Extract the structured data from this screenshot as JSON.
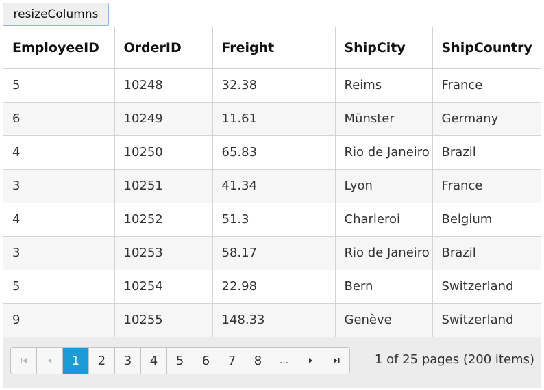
{
  "toolbar": {
    "resize_label": "resizeColumns"
  },
  "grid": {
    "columns": [
      "EmployeeID",
      "OrderID",
      "Freight",
      "ShipCity",
      "ShipCountry"
    ],
    "rows": [
      [
        "5",
        "10248",
        "32.38",
        "Reims",
        "France"
      ],
      [
        "6",
        "10249",
        "11.61",
        "Münster",
        "Germany"
      ],
      [
        "4",
        "10250",
        "65.83",
        "Rio de Janeiro",
        "Brazil"
      ],
      [
        "3",
        "10251",
        "41.34",
        "Lyon",
        "France"
      ],
      [
        "4",
        "10252",
        "51.3",
        "Charleroi",
        "Belgium"
      ],
      [
        "3",
        "10253",
        "58.17",
        "Rio de Janeiro",
        "Brazil"
      ],
      [
        "5",
        "10254",
        "22.98",
        "Bern",
        "Switzerland"
      ],
      [
        "9",
        "10255",
        "148.33",
        "Genève",
        "Switzerland"
      ]
    ]
  },
  "pager": {
    "first_icon": "first-page-icon",
    "prev_icon": "previous-page-icon",
    "next_icon": "next-page-icon",
    "last_icon": "last-page-icon",
    "pages": [
      "1",
      "2",
      "3",
      "4",
      "5",
      "6",
      "7",
      "8"
    ],
    "current_page": "1",
    "more_label": "...",
    "info": "1 of 25 pages (200 items)",
    "accent_color": "#1a9ad6"
  }
}
